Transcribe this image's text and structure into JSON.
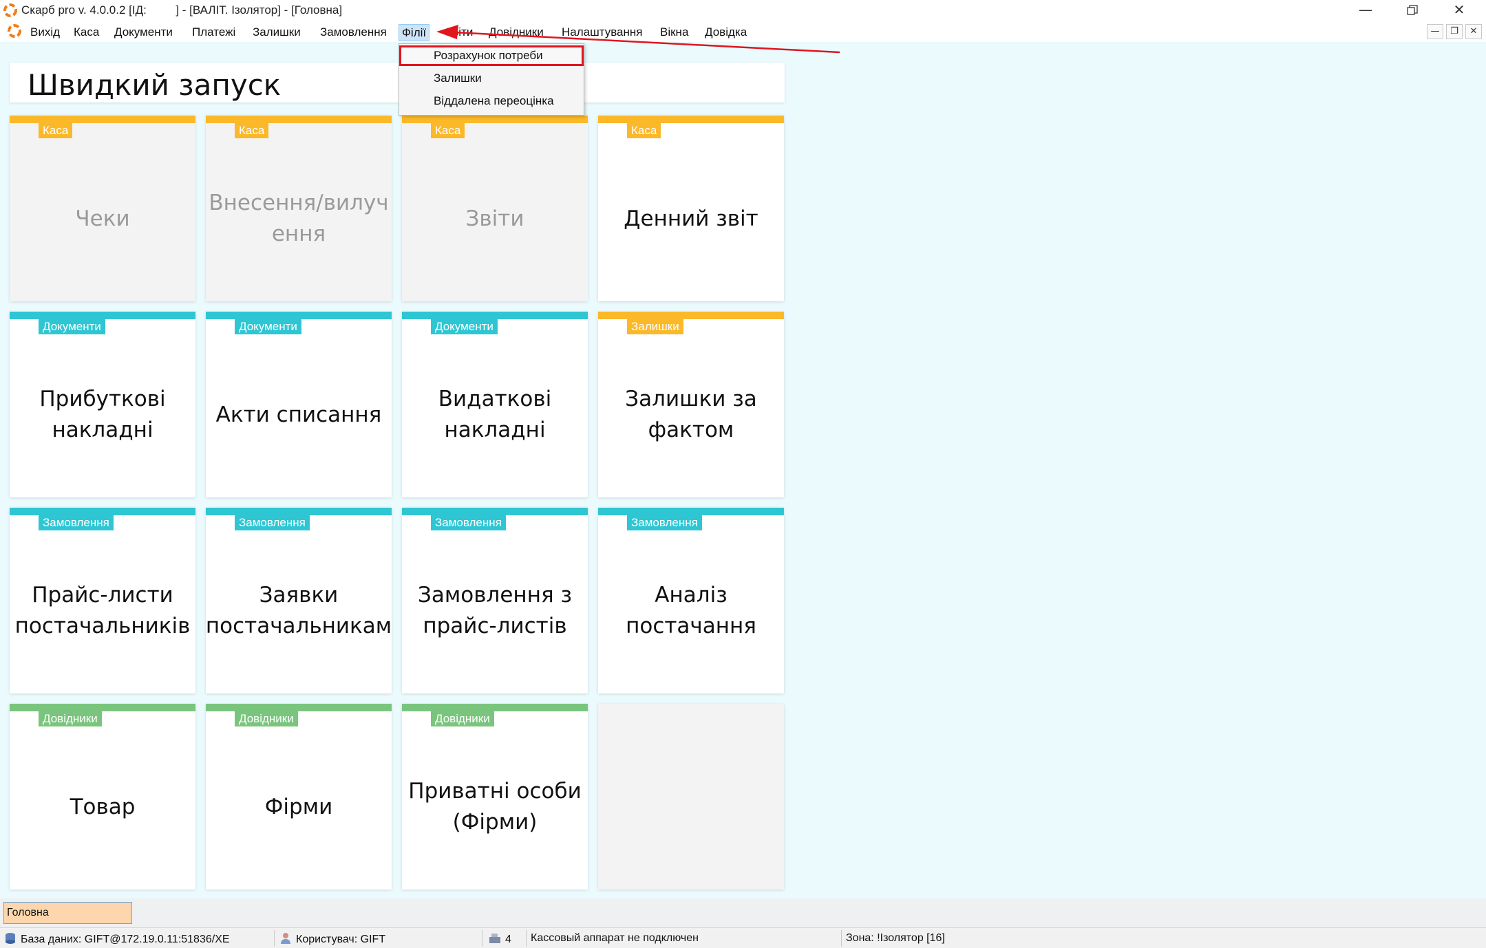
{
  "window": {
    "title": "Скарб pro v. 4.0.0.2 [ІД:         ] - [ВАЛІТ. Ізолятор] - [Головна]",
    "minimize_icon": "minimize-icon",
    "restore_icon": "restore-icon",
    "close_icon": "close-icon"
  },
  "menu": {
    "items": [
      {
        "label": "Вихід"
      },
      {
        "label": "Каса"
      },
      {
        "label": "Документи"
      },
      {
        "label": "Платежі"
      },
      {
        "label": "Залишки"
      },
      {
        "label": "Замовлення"
      },
      {
        "label": "Філії"
      },
      {
        "label": "Звіти"
      },
      {
        "label": "Довідники"
      },
      {
        "label": "Налаштування"
      },
      {
        "label": "Вікна"
      },
      {
        "label": "Довідка"
      }
    ],
    "active_item": "Філії"
  },
  "dropdown": {
    "items": [
      {
        "label": "Розрахунок потреби"
      },
      {
        "label": "Залишки"
      },
      {
        "label": "Віддалена переоцінка"
      }
    ]
  },
  "quick_start": {
    "title": "Швидкий запуск",
    "tiles": [
      {
        "tag": "Каса",
        "label": "Чеки"
      },
      {
        "tag": "Каса",
        "label": "Внесення/вилучення"
      },
      {
        "tag": "Каса",
        "label": "Звіти"
      },
      {
        "tag": "Каса",
        "label": "Денний звіт"
      },
      {
        "tag": "Документи",
        "label": "Прибуткові накладні"
      },
      {
        "tag": "Документи",
        "label": "Акти списання"
      },
      {
        "tag": "Документи",
        "label": "Видаткові накладні"
      },
      {
        "tag": "Залишки",
        "label": "Залишки за фактом"
      },
      {
        "tag": "Замовлення",
        "label": "Прайс-листи постачальників"
      },
      {
        "tag": "Замовлення",
        "label": "Заявки постачальникам"
      },
      {
        "tag": "Замовлення",
        "label": "Замовлення з прайс-листів"
      },
      {
        "tag": "Замовлення",
        "label": "Аналіз постачання"
      },
      {
        "tag": "Довідники",
        "label": "Товар"
      },
      {
        "tag": "Довідники",
        "label": "Фірми"
      },
      {
        "tag": "Довідники",
        "label": "Приватні особи (Фірми)"
      }
    ]
  },
  "colors": {
    "kasa": "#fbb829",
    "documents": "#2ec6d3",
    "stock": "#fbb829",
    "orders": "#2ec6d3",
    "directories": "#7ac57d",
    "annotation_red": "#e0151e"
  },
  "tabs": {
    "home": "Головна"
  },
  "status": {
    "database": "База даних: GIFT@172.19.0.11:51836/XE",
    "user": "Користувач: GIFT",
    "count": "4",
    "cash_register": "Кассовый аппарат не подключен",
    "zone": "Зона: !Ізолятор [16]"
  }
}
